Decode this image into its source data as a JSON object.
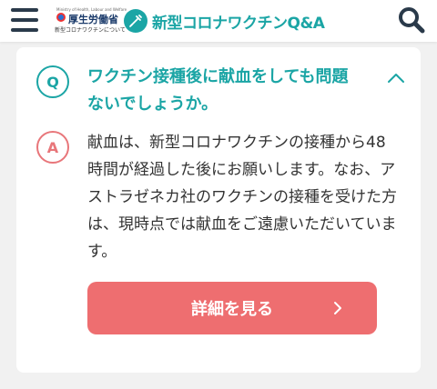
{
  "header": {
    "ministry": {
      "tagline": "Ministry of Health, Labour and Welfare",
      "name": "厚生労働省",
      "subtitle": "新型コロナワクチンについて"
    },
    "brand_title": "新型コロナワクチンQ&A"
  },
  "faq": {
    "q_badge": "Q",
    "question": "ワクチン接種後に献血をしても問題ないでしょうか。",
    "a_badge": "A",
    "answer": "献血は、新型コロナワクチンの接種から48時間が経過した後にお願いします。なお、アストラゼネカ社のワクチンの接種を受けた方は、現時点では献血をご遠慮いただいています。",
    "detail_button": "詳細を見る"
  },
  "colors": {
    "accent_teal": "#1ba5a5",
    "accent_red": "#ee6e70",
    "text": "#333333",
    "background": "#f1f1f1"
  },
  "icons": {
    "menu": "hamburger-menu-icon",
    "brand": "syringe-icon",
    "search": "search-icon",
    "collapse": "chevron-up-icon",
    "detail": "chevron-right-icon"
  }
}
